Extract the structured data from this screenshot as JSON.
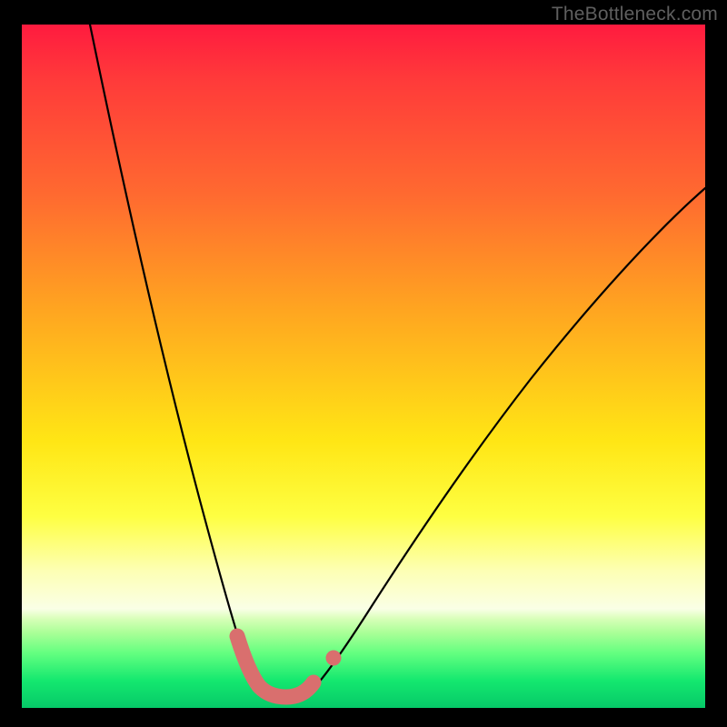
{
  "watermark": {
    "text": "TheBottleneck.com"
  },
  "colors": {
    "gradient_top": "#ff1b3f",
    "gradient_bottom": "#06c968",
    "curve": "#000000",
    "marker": "#d96f6e",
    "frame_bg": "#000000"
  },
  "chart_data": {
    "type": "line",
    "title": "",
    "xlabel": "",
    "ylabel": "",
    "xlim": [
      0,
      100
    ],
    "ylim": [
      0,
      100
    ],
    "note": "Bottleneck-style V-curve; axes are unlabeled percentages. Y=0 (bottom) is optimal/green, Y=100 (top) is worst/red. Values estimated from pixel positions.",
    "series": [
      {
        "name": "bottleneck-curve",
        "x": [
          10,
          13,
          16,
          19,
          22,
          25,
          27,
          29,
          31,
          33,
          35,
          37,
          40,
          43,
          46,
          50,
          55,
          60,
          65,
          70,
          75,
          80,
          85,
          90,
          95,
          100
        ],
        "y": [
          100,
          88,
          76,
          64,
          52,
          41,
          32,
          23,
          14,
          7,
          3,
          2,
          2,
          3,
          6,
          10,
          17,
          25,
          33,
          41,
          49,
          56,
          63,
          69,
          74,
          79
        ]
      }
    ],
    "markers": {
      "name": "highlighted-optimal-range",
      "x": [
        31.5,
        33,
        35,
        37,
        39,
        41,
        42.6
      ],
      "y": [
        10.5,
        5.5,
        2.5,
        2,
        2,
        2.5,
        4
      ],
      "extra_dot": {
        "x": 45.6,
        "y": 7.3
      }
    }
  }
}
